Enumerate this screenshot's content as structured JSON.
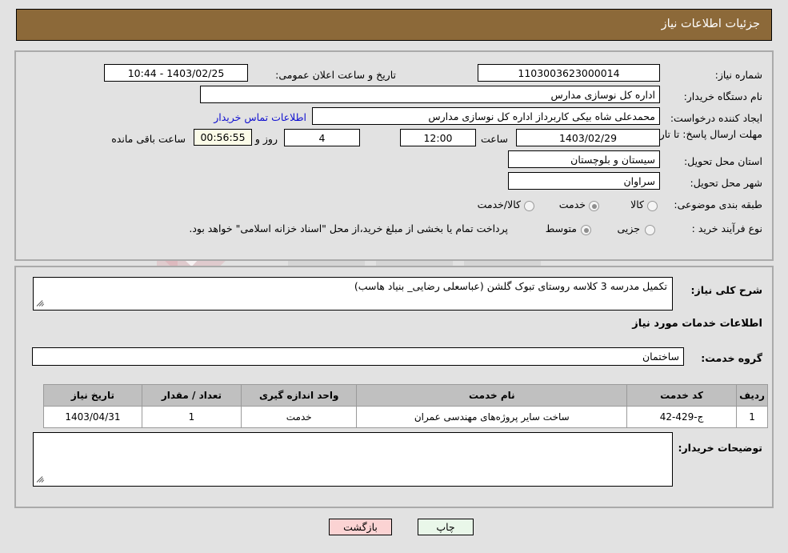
{
  "header": {
    "title": "جزئیات اطلاعات نیاز",
    "bar_color": "#8c6939"
  },
  "watermark": {
    "text": "AriaTender.net"
  },
  "top_form": {
    "need_number": {
      "label": "شماره نیاز:",
      "value": "1103003623000014"
    },
    "announce_datetime": {
      "label": "تاریخ و ساعت اعلان عمومی:",
      "value": "1403/02/25 - 10:44"
    },
    "buyer_org": {
      "label": "نام دستگاه خریدار:",
      "value": "اداره کل نوسازی مدارس"
    },
    "request_creator": {
      "label": "ایجاد کننده درخواست:",
      "value": "محمدعلی شاه بیکی کاربرداز اداره کل نوسازی مدارس"
    },
    "buyer_contact_link": "اطلاعات تماس خریدار",
    "deadline": {
      "label": "مهلت ارسال پاسخ: تا تاریخ:",
      "date": "1403/02/29",
      "time_label": "ساعت",
      "time": "12:00",
      "days": "4",
      "days_label": "روز و",
      "countdown": "00:56:55",
      "countdown_label": "ساعت باقی مانده"
    },
    "delivery_province": {
      "label": "استان محل تحویل:",
      "value": "سیستان و بلوچستان"
    },
    "delivery_city": {
      "label": "شهر محل تحویل:",
      "value": "سراوان"
    },
    "category": {
      "label": "طبقه بندی موضوعی:",
      "options": [
        "کالا",
        "خدمت",
        "کالا/خدمت"
      ],
      "selected": "خدمت"
    },
    "purchase_process": {
      "label": "نوع فرآیند خرید :",
      "options": [
        "جزیی",
        "متوسط"
      ],
      "selected": "متوسط"
    },
    "payment_note": "پرداخت تمام یا بخشی از مبلغ خرید،از محل \"اسناد خزانه اسلامی\" خواهد بود."
  },
  "bottom": {
    "need_desc": {
      "label": "شرح کلی نیاز:",
      "value": "تکمیل مدرسه 3 کلاسه روستای تبوک گلشن (عباسعلی رضایی_ بنیاد هاسب)"
    },
    "services_heading": "اطلاعات خدمات مورد نیاز",
    "service_group": {
      "label": "گروه خدمت:",
      "value": "ساختمان"
    },
    "table": {
      "columns": [
        "ردیف",
        "کد خدمت",
        "نام خدمت",
        "واحد اندازه گیری",
        "تعداد / مقدار",
        "تاریخ نیاز"
      ],
      "rows": [
        {
          "radif": "1",
          "code": "ج-429-42",
          "name": "ساخت سایر پروژه‌های مهندسی عمران",
          "unit": "خدمت",
          "qty": "1",
          "date": "1403/04/31"
        }
      ]
    },
    "buyer_notes": {
      "label": "توضیحات خریدار:",
      "value": ""
    }
  },
  "footer": {
    "print_label": "چاپ",
    "back_label": "بازگشت"
  }
}
